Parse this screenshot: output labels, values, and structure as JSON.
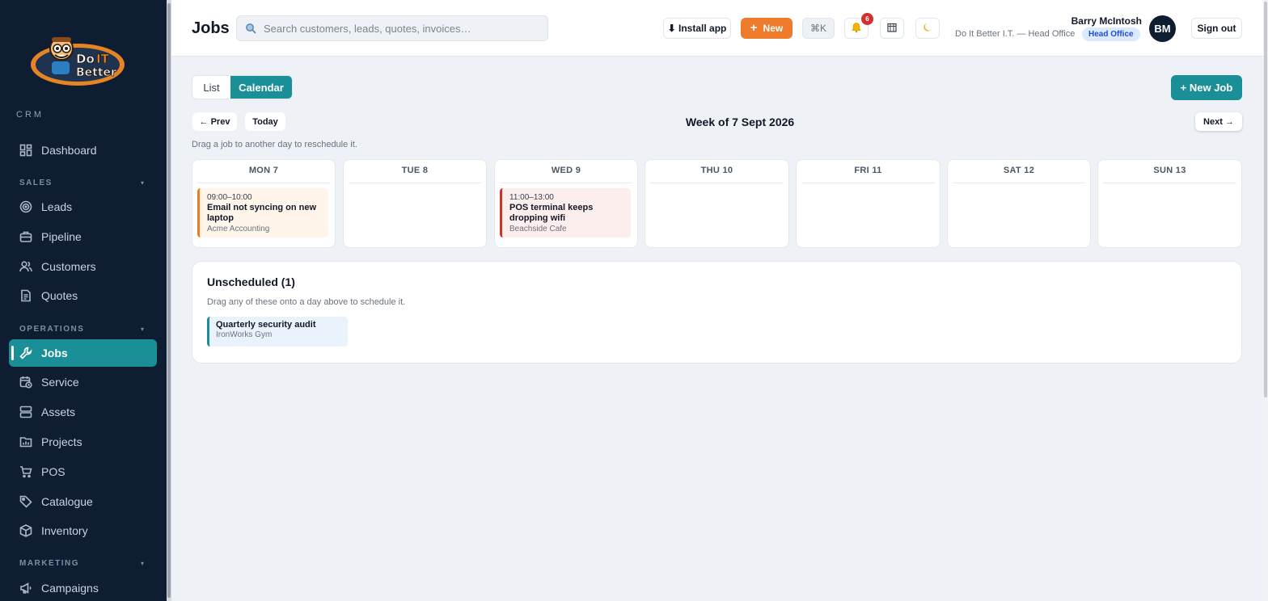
{
  "sidebar": {
    "logo_text": "Do IT Better",
    "crm_label": "CRM",
    "sections": {
      "sales": "SALES",
      "operations": "OPERATIONS",
      "marketing": "MARKETING"
    },
    "items": [
      {
        "label": "Dashboard",
        "icon": "dashboard-icon"
      },
      {
        "label": "Leads",
        "icon": "target-icon"
      },
      {
        "label": "Pipeline",
        "icon": "briefcase-icon"
      },
      {
        "label": "Customers",
        "icon": "users-icon"
      },
      {
        "label": "Quotes",
        "icon": "document-icon"
      },
      {
        "label": "Jobs",
        "icon": "wrench-icon",
        "active": true
      },
      {
        "label": "Service",
        "icon": "calendar-clock-icon"
      },
      {
        "label": "Assets",
        "icon": "server-icon"
      },
      {
        "label": "Projects",
        "icon": "folder-chart-icon"
      },
      {
        "label": "POS",
        "icon": "cart-icon"
      },
      {
        "label": "Catalogue",
        "icon": "tag-icon"
      },
      {
        "label": "Inventory",
        "icon": "box-icon"
      },
      {
        "label": "Campaigns",
        "icon": "megaphone-icon"
      }
    ]
  },
  "header": {
    "title": "Jobs",
    "search_placeholder": "Search customers, leads, quotes, invoices…",
    "install_label": "⬇ Install app",
    "new_label": "New",
    "cmdk_label": "⌘K",
    "notification_count": "6",
    "user_name": "Barry McIntosh",
    "user_org": "Do It Better I.T. — Head Office",
    "user_pill": "Head Office",
    "avatar_initials": "BM",
    "signout_label": "Sign out"
  },
  "view_toggle": {
    "list_label": "List",
    "calendar_label": "Calendar",
    "selected": "Calendar"
  },
  "new_job_label": "+ New Job",
  "nav": {
    "prev_label": "← Prev",
    "today_label": "Today",
    "next_label": "Next →",
    "week_title": "Week of 7 Sept 2026",
    "hint": "Drag a job to another day to reschedule it."
  },
  "days": [
    {
      "label": "MON 7",
      "jobs": [
        {
          "time": "09:00–10:00",
          "title": "Email not syncing on new laptop",
          "client": "Acme Accounting",
          "color": "#e67e22"
        }
      ]
    },
    {
      "label": "TUE 8",
      "jobs": []
    },
    {
      "label": "WED 9",
      "jobs": [
        {
          "time": "11:00–13:00",
          "title": "POS terminal keeps dropping wifi",
          "client": "Beachside Cafe",
          "color": "#c0392b"
        }
      ]
    },
    {
      "label": "THU 10",
      "jobs": []
    },
    {
      "label": "FRI 11",
      "jobs": []
    },
    {
      "label": "SAT 12",
      "jobs": []
    },
    {
      "label": "SUN 13",
      "jobs": []
    }
  ],
  "unscheduled": {
    "title": "Unscheduled (1)",
    "hint": "Drag any of these onto a day above to schedule it.",
    "items": [
      {
        "title": "Quarterly security audit",
        "client": "IronWorks Gym"
      }
    ]
  },
  "colors": {
    "sidebar_bg": "#0f1d33",
    "accent": "#1a8f97",
    "new_button": "#ee7a2c"
  }
}
